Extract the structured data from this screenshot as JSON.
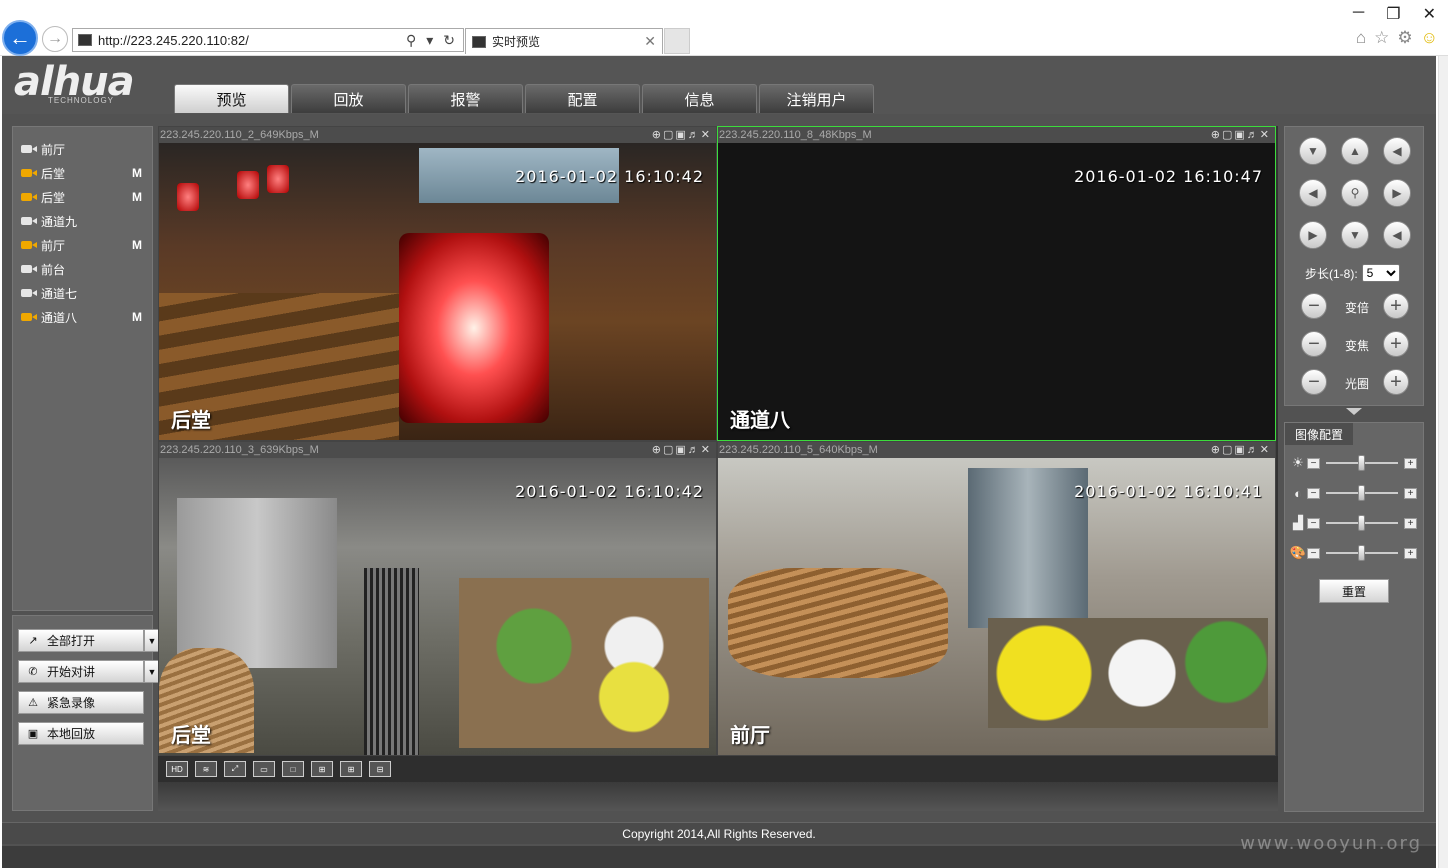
{
  "browser": {
    "url": "http://223.245.220.110:82/",
    "tab_title": "实时预览",
    "window_buttons": [
      "─",
      "❐",
      "✕"
    ]
  },
  "app": {
    "logo": "alhua",
    "logo_sub": "TECHNOLOGY",
    "menu": [
      "预览",
      "回放",
      "报警",
      "配置",
      "信息",
      "注销用户"
    ],
    "active_menu": "预览",
    "channels": [
      {
        "name": "前厅",
        "status": "off",
        "m": ""
      },
      {
        "name": "后堂",
        "status": "on",
        "m": "M"
      },
      {
        "name": "后堂",
        "status": "on",
        "m": "M"
      },
      {
        "name": "通道九",
        "status": "off",
        "m": ""
      },
      {
        "name": "前厅",
        "status": "on",
        "m": "M"
      },
      {
        "name": "前台",
        "status": "off",
        "m": ""
      },
      {
        "name": "通道七",
        "status": "off",
        "m": ""
      },
      {
        "name": "通道八",
        "status": "on",
        "m": "M"
      }
    ],
    "controls": {
      "open_all": "全部打开",
      "talk": "开始对讲",
      "emergency": "紧急录像",
      "local_playback": "本地回放"
    },
    "videos": [
      {
        "stream": "223.245.220.110_2_649Kbps_M",
        "timestamp": "2016-01-02 16:10:42",
        "name": "后堂",
        "selected": false
      },
      {
        "stream": "223.245.220.110_8_48Kbps_M",
        "timestamp": "2016-01-02 16:10:47",
        "name": "通道八",
        "selected": true
      },
      {
        "stream": "223.245.220.110_3_639Kbps_M",
        "timestamp": "2016-01-02 16:10:42",
        "name": "后堂",
        "selected": false
      },
      {
        "stream": "223.245.220.110_5_640Kbps_M",
        "timestamp": "2016-01-02 16:10:41",
        "name": "前厅",
        "selected": false
      }
    ],
    "grid_toolbar": [
      "HD",
      "≋",
      "⤢",
      "▭",
      "□",
      "⊞",
      "⊞",
      "⊟"
    ],
    "ptz": {
      "step_label": "步长(1-8):",
      "step_value": "5",
      "zoom": "变倍",
      "focus": "变焦",
      "iris": "光圈"
    },
    "image_config": {
      "title": "图像配置",
      "sliders": [
        {
          "icon": "brightness-icon",
          "glyph": "☀",
          "value": 0.5
        },
        {
          "icon": "contrast-icon",
          "glyph": "◐",
          "value": 0.5
        },
        {
          "icon": "saturation-icon",
          "glyph": "▟",
          "value": 0.5
        },
        {
          "icon": "hue-icon",
          "glyph": "🎨",
          "value": 0.5
        }
      ],
      "reset": "重置"
    },
    "copyright": "Copyright 2014,All Rights Reserved.",
    "watermark": "www.wooyun.org"
  },
  "colors": {
    "selected_border": "#3cdc3c",
    "channel_on": "#f0a800",
    "channel_off": "#e6e6e6"
  }
}
